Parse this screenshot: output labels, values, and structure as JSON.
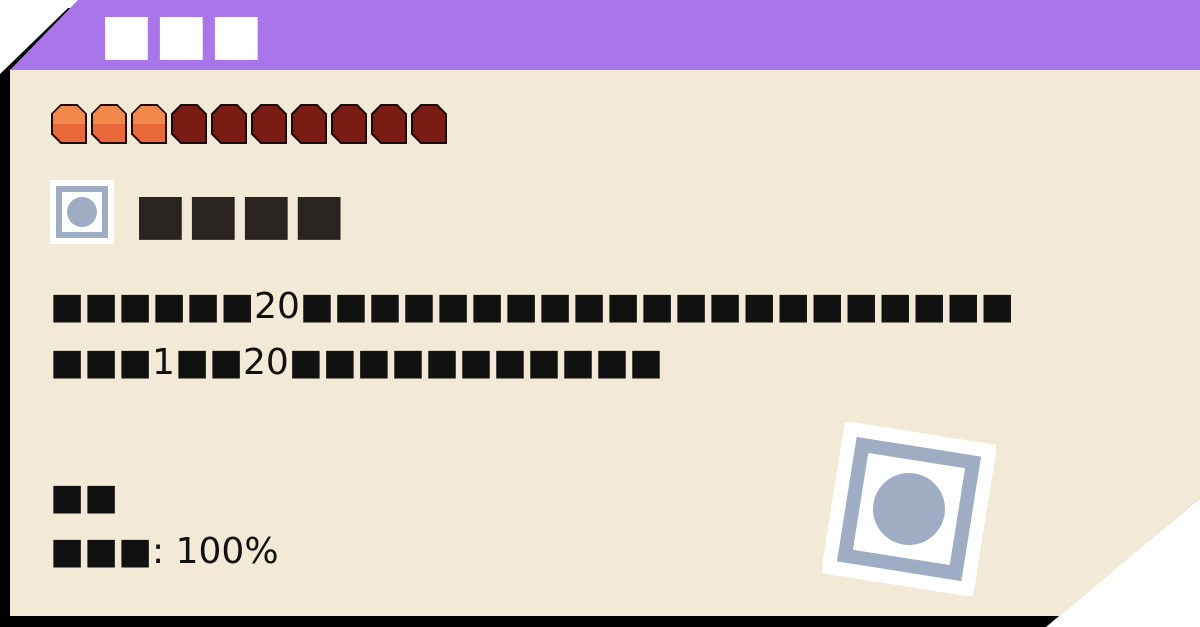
{
  "card": {
    "title": "■■■",
    "skill_name": "■■■■",
    "colors": {
      "header": "#a876e8",
      "body": "#f2ead6",
      "frame": "#000000",
      "pip_filled": "#e8683a",
      "pip_empty": "#7a1c14",
      "icon": "#9eadc4"
    }
  },
  "cost": {
    "filled": 3,
    "total": 10
  },
  "icon": {
    "name": "circle-in-square-icon"
  },
  "description": {
    "line1": "■■■■■■20■■■■■■■■■■■■■■■■■■■■■",
    "line2": "■■■1■■20■■■■■■■■■■■"
  },
  "meta": {
    "type_label": "■■",
    "accuracy_label": "■■■: 100%"
  }
}
